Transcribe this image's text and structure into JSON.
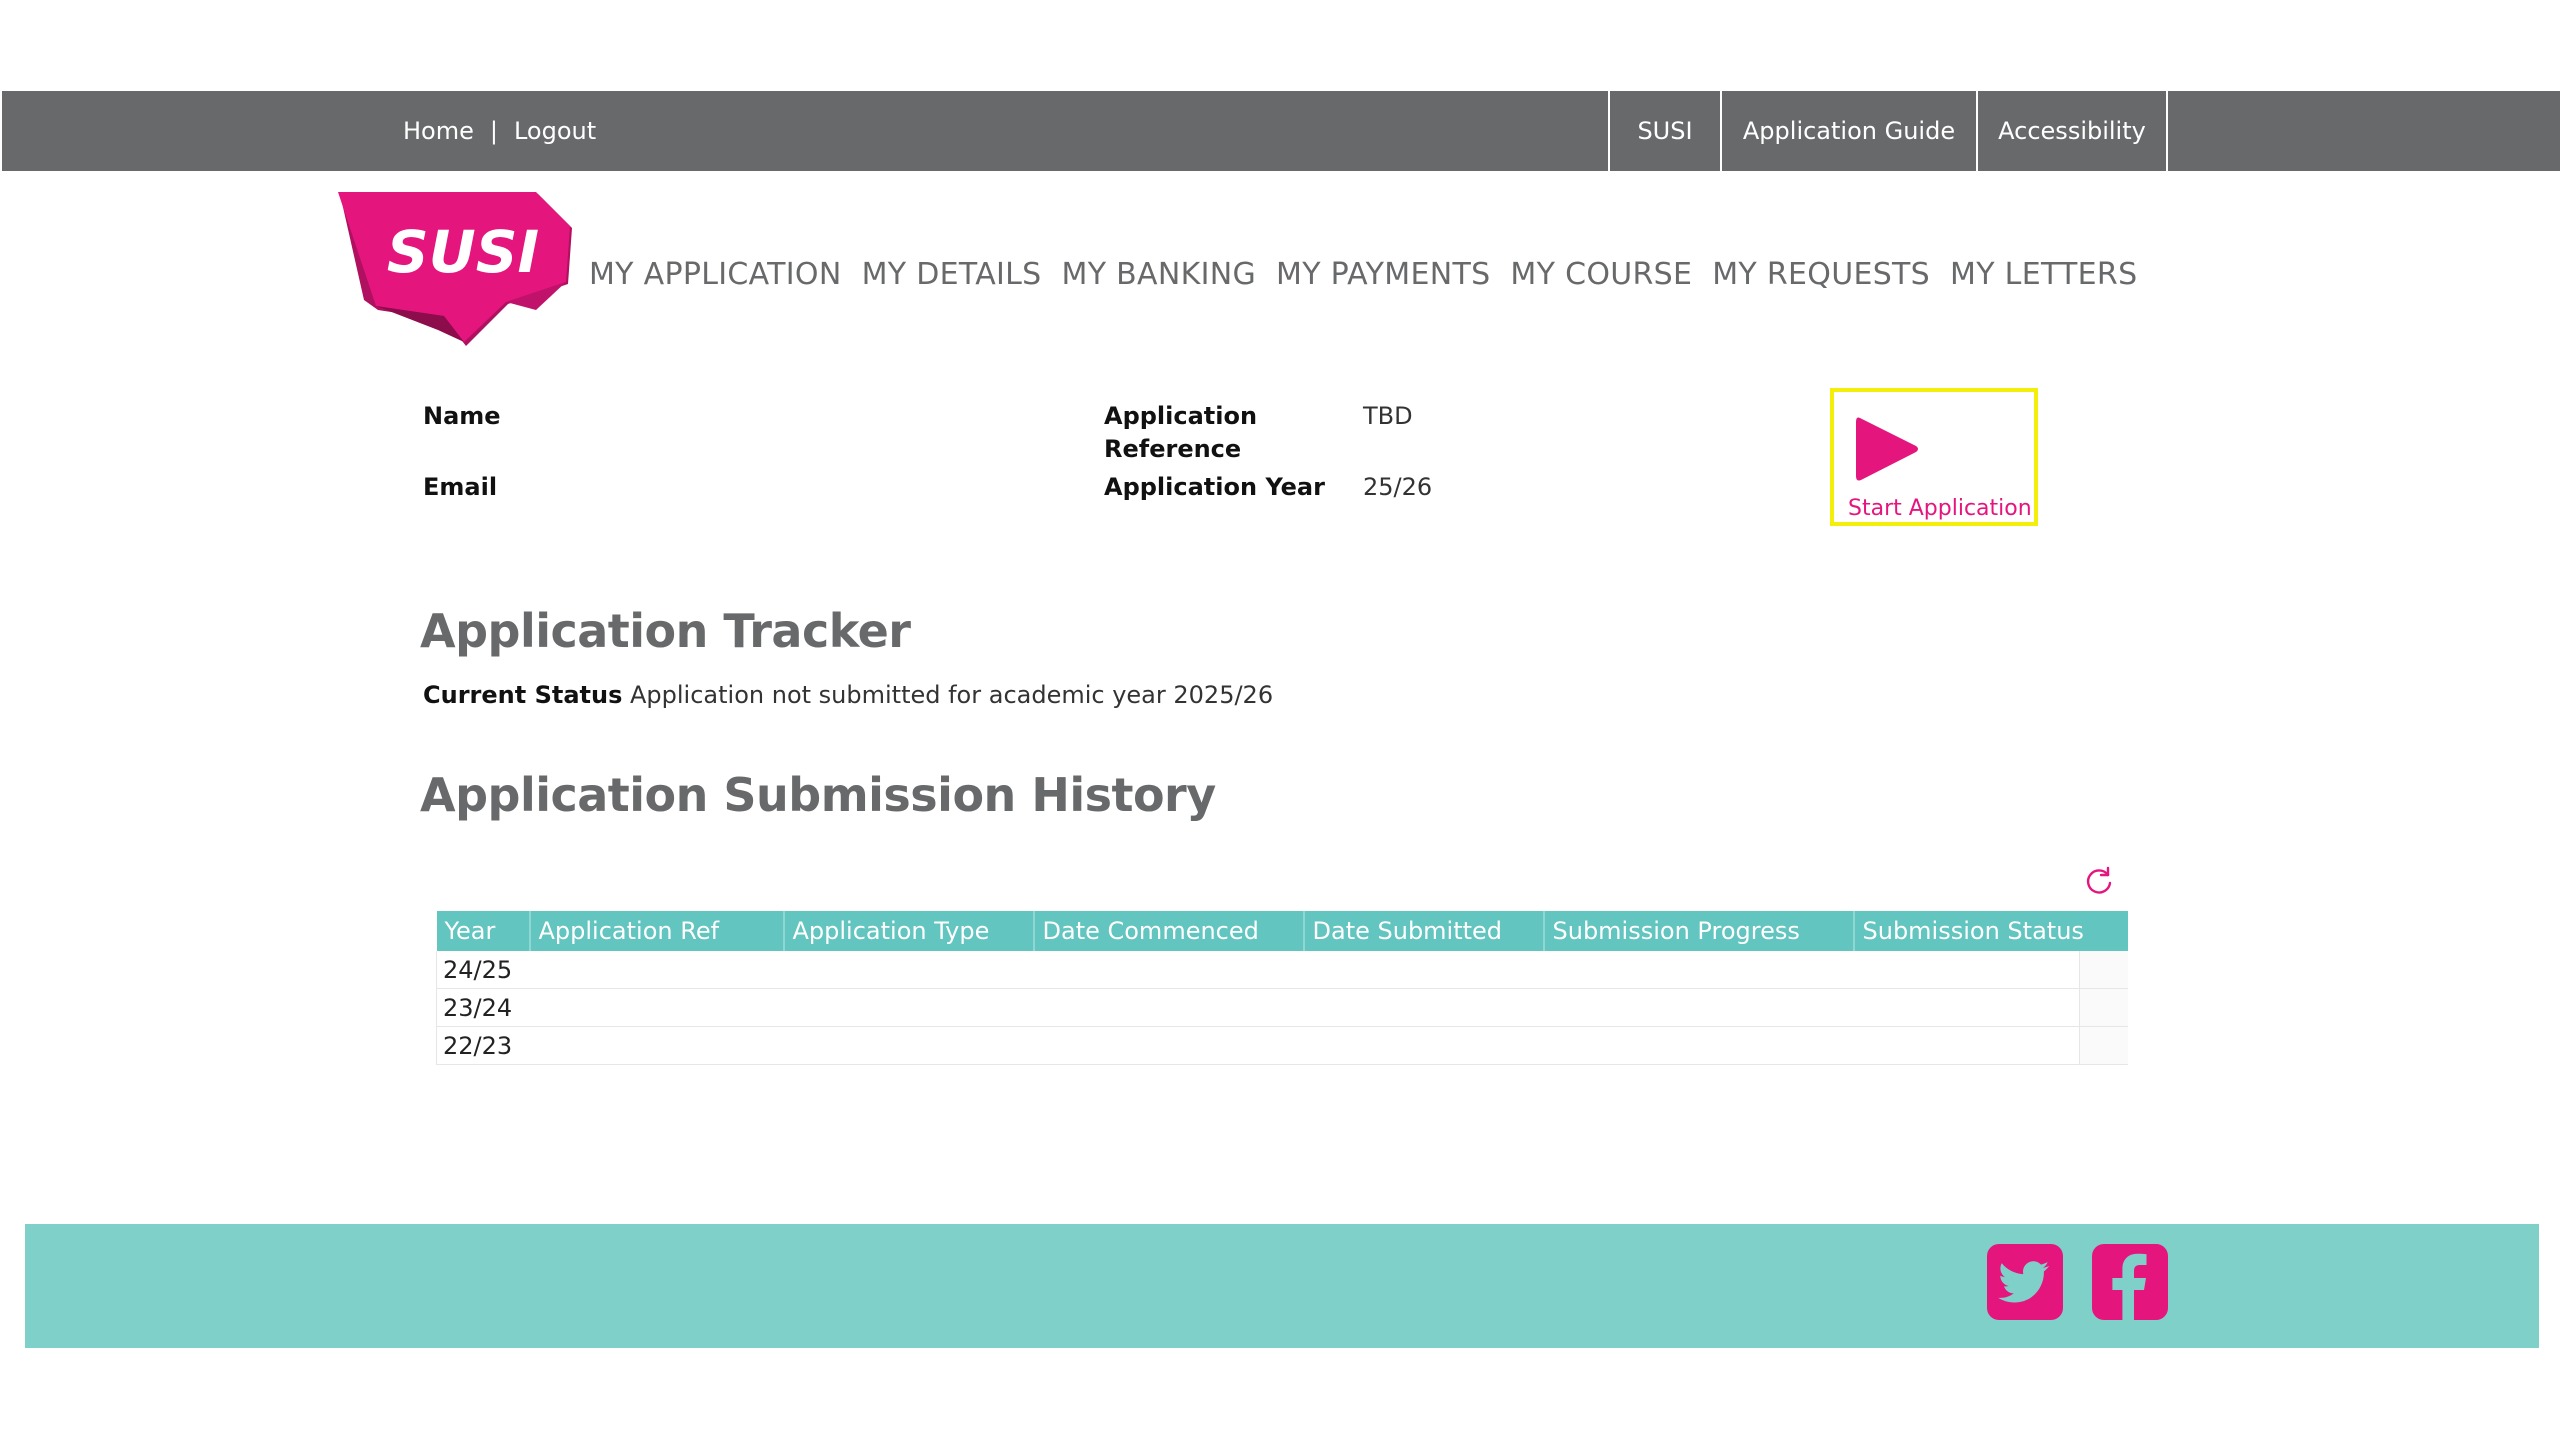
{
  "topbar": {
    "home": "Home",
    "separator": "|",
    "logout": "Logout",
    "links": [
      "SUSI",
      "Application Guide",
      "Accessibility"
    ]
  },
  "logo": {
    "text": "SUSI"
  },
  "nav": [
    "MY APPLICATION",
    "MY DETAILS",
    "MY BANKING",
    "MY PAYMENTS",
    "MY COURSE",
    "MY REQUESTS",
    "MY LETTERS"
  ],
  "profile": {
    "name_label": "Name",
    "email_label": "Email",
    "ref_label_line1": "Application",
    "ref_label_line2": "Reference",
    "ref_value": "TBD",
    "year_label": "Application Year",
    "year_value": "25/26"
  },
  "start_button": {
    "label": "Start Application"
  },
  "tracker": {
    "title": "Application Tracker",
    "status_label": "Current Status",
    "status_text": "Application not submitted for academic year 2025/26"
  },
  "history": {
    "title": "Application Submission History",
    "columns": [
      "Year",
      "Application Ref",
      "Application Type",
      "Date Commenced",
      "Date Submitted",
      "Submission Progress",
      "Submission Status"
    ],
    "rows": [
      {
        "year": "24/25"
      },
      {
        "year": "23/24"
      },
      {
        "year": "22/23"
      }
    ]
  },
  "colors": {
    "brand_pink": "#e5157e",
    "teal": "#7fd0c9",
    "header_teal": "#62c5bf",
    "topbar_grey": "#68696b",
    "highlight_yellow": "#f4ee0b"
  },
  "icons": [
    "play-icon",
    "refresh-icon",
    "twitter-icon",
    "facebook-icon"
  ]
}
